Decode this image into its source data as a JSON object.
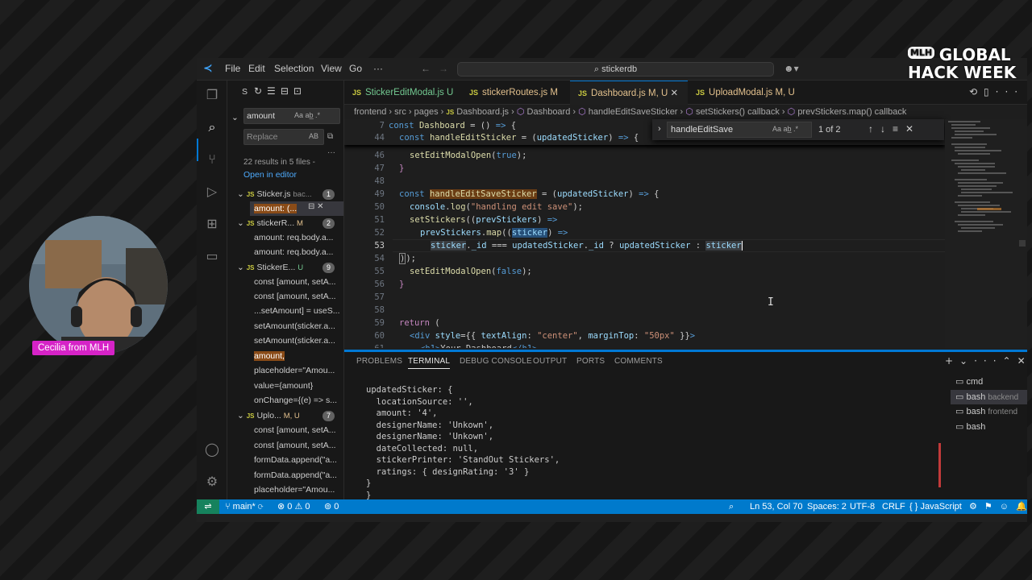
{
  "menu": {
    "file": "File",
    "edit": "Edit",
    "selection": "Selection",
    "view": "View",
    "go": "Go",
    "more": "···"
  },
  "command_center": "stickerdb",
  "sidebar": {
    "title": "S",
    "search_value": "amount",
    "replace_placeholder": "Replace",
    "summary": "22 results in 5 files -",
    "open_in_editor": "Open in editor",
    "groups": [
      {
        "file": "Sticker.js",
        "detail": "bac...",
        "count": "1",
        "items": [
          "amount: (..."
        ]
      },
      {
        "file": "stickerR...",
        "detail": "M",
        "count": "2",
        "items": [
          "amount: req.body.a...",
          "amount: req.body.a..."
        ]
      },
      {
        "file": "StickerE...",
        "detail": "U",
        "count": "9",
        "items": [
          "const [amount, setA...",
          "const [amount, setA...",
          "...setAmount] = useS...",
          "setAmount(sticker.a...",
          "setAmount(sticker.a...",
          "amount,",
          "placeholder=\"Amou...",
          "value={amount}",
          "onChange={(e) => s..."
        ]
      },
      {
        "file": "Uplo...",
        "detail": "M, U",
        "count": "7",
        "items": [
          "const [amount, setA...",
          "const [amount, setA...",
          "formData.append(\"a...",
          "formData.append(\"a...",
          "placeholder=\"Amou..."
        ]
      }
    ]
  },
  "tabs": [
    {
      "label": "StickerEditModal.js",
      "status": "U",
      "active": false
    },
    {
      "label": "stickerRoutes.js",
      "status": "M",
      "active": false
    },
    {
      "label": "Dashboard.js",
      "status": "M, U",
      "active": true
    },
    {
      "label": "UploadModal.js",
      "status": "M, U",
      "active": false
    }
  ],
  "breadcrumb": [
    "frontend",
    "src",
    "pages",
    "Dashboard.js",
    "Dashboard",
    "handleEditSaveSticker",
    "setStickers() callback",
    "prevStickers.map() callback"
  ],
  "find": {
    "query": "handleEditSave",
    "count": "1 of 2"
  },
  "code": {
    "sticky": [
      {
        "ln": "7",
        "text": "const Dashboard = () => {"
      },
      {
        "ln": "44",
        "text": "const handleEditSticker = (updatedSticker) => {"
      }
    ],
    "lines": [
      "46",
      "47",
      "48",
      "49",
      "50",
      "51",
      "52",
      "53",
      "54",
      "55",
      "56",
      "57",
      "58",
      "59",
      "60",
      "61"
    ]
  },
  "panel": {
    "tabs": [
      "PROBLEMS",
      "TERMINAL",
      "DEBUG CONSOLE",
      "OUTPUT",
      "PORTS",
      "COMMENTS"
    ],
    "terminal": "updatedSticker: {\n  locationSource: '',\n  amount: '4',\n  designerName: 'Unkown',\n  designerName: 'Unkown',\n  dateCollected: null,\n  stickerPrinter: 'StandOut Stickers',\n  ratings: { designRating: '3' }\n}\n}",
    "terminals": [
      {
        "name": "cmd",
        "sub": "",
        "selected": false
      },
      {
        "name": "bash",
        "sub": "backend",
        "selected": true
      },
      {
        "name": "bash",
        "sub": "frontend",
        "selected": false
      },
      {
        "name": "bash",
        "sub": "",
        "selected": false
      }
    ]
  },
  "status": {
    "branch": "main*",
    "problems": "0",
    "warnings": "0",
    "ports": "0",
    "position": "Ln 53, Col 70",
    "spaces": "Spaces: 2",
    "encoding": "UTF-8",
    "eol": "CRLF",
    "language": "JavaScript"
  },
  "webcam": {
    "name": "Cecilia from MLH"
  },
  "event": {
    "badge": "MLH",
    "line1": "GLOBAL",
    "line2": "HACK WEEK"
  },
  "colors": {
    "accent": "#007acc",
    "match": "#8a4b17",
    "webcam_label": "#d623c7"
  }
}
